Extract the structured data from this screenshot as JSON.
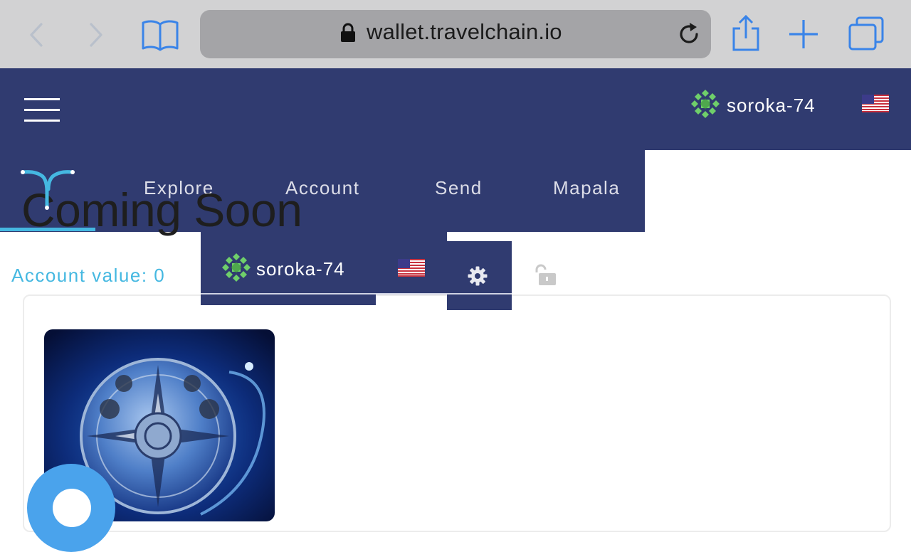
{
  "browser": {
    "url": "wallet.travelchain.io"
  },
  "header": {
    "username": "soroka-74"
  },
  "nav": {
    "items": [
      "Explore",
      "Account",
      "Send",
      "Mapala"
    ]
  },
  "dropdown": {
    "username": "soroka-74"
  },
  "main": {
    "banner": "Coming Soon",
    "account_value": "Account value: 0"
  },
  "colors": {
    "header_bg": "#303b70",
    "accent": "#45b8e1",
    "fab": "#4aa3ec"
  }
}
